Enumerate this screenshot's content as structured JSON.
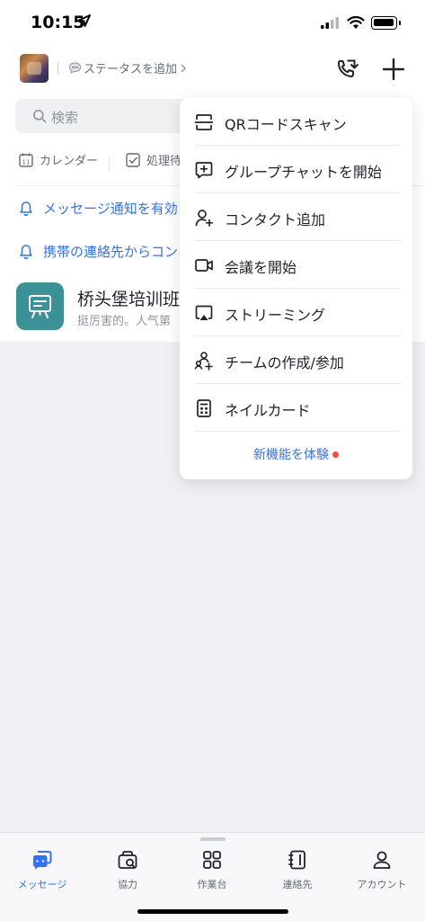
{
  "status_bar": {
    "time": "10:15"
  },
  "header": {
    "status_label": "ステータスを追加"
  },
  "search": {
    "placeholder": "検索"
  },
  "quick": {
    "calendar": "カレンダー",
    "todo": "処理待"
  },
  "notices": [
    {
      "text": "メッセージ通知を有効"
    },
    {
      "text": "携帯の連絡先からコン"
    }
  ],
  "chat": {
    "name": "桥头堡培训班",
    "preview": "挺厉害的。人气第"
  },
  "menu": {
    "items": [
      {
        "label": "QRコードスキャン",
        "icon": "qr-scan-icon"
      },
      {
        "label": "グループチャットを開始",
        "icon": "group-chat-icon"
      },
      {
        "label": "コンタクト追加",
        "icon": "add-contact-icon"
      },
      {
        "label": "会議を開始",
        "icon": "video-icon"
      },
      {
        "label": "ストリーミング",
        "icon": "screen-cast-icon"
      },
      {
        "label": "チームの作成/参加",
        "icon": "team-icon"
      },
      {
        "label": "ネイルカード",
        "icon": "business-card-icon"
      }
    ],
    "new_feature": "新機能を体験"
  },
  "tabs": [
    {
      "label": "メッセージ",
      "icon": "message-icon",
      "active": true
    },
    {
      "label": "協力",
      "icon": "collab-icon"
    },
    {
      "label": "作業台",
      "icon": "workspace-icon"
    },
    {
      "label": "連絡先",
      "icon": "contacts-icon"
    },
    {
      "label": "アカウント",
      "icon": "account-icon"
    }
  ],
  "colors": {
    "accent": "#3370ff",
    "notify_dot": "#f54a45",
    "chat_avatar": "#3a9196"
  }
}
